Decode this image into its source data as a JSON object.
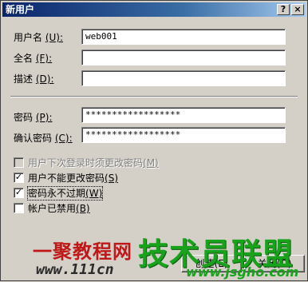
{
  "window": {
    "title": "新用户",
    "help_glyph": "?",
    "close_glyph": "×"
  },
  "form": {
    "username": {
      "label": "用户名",
      "mnemonic": "(U):",
      "value": "web001"
    },
    "fullname": {
      "label": "全名",
      "mnemonic": "(F):",
      "value": ""
    },
    "description": {
      "label": "描述",
      "mnemonic": "(D):",
      "value": ""
    },
    "password": {
      "label": "密码",
      "mnemonic": "(P):",
      "value": "******************"
    },
    "confirm_password": {
      "label": "确认密码",
      "mnemonic": "(C):",
      "value": "******************"
    }
  },
  "checkboxes": [
    {
      "label": "用户下次登录时须更改密码",
      "mnemonic": "(M)",
      "checked": false,
      "disabled": true,
      "mark": ""
    },
    {
      "label": "用户不能更改密码",
      "mnemonic": "(S)",
      "checked": true,
      "disabled": false,
      "mark": "✓"
    },
    {
      "label": "密码永不过期",
      "mnemonic": "(W)",
      "checked": true,
      "disabled": false,
      "mark": "✓"
    },
    {
      "label": "帐户已禁用",
      "mnemonic": "(B)",
      "checked": false,
      "disabled": false,
      "mark": ""
    }
  ],
  "buttons": {
    "create": "创建(E)",
    "close": "关闭(O)"
  },
  "watermark": {
    "brand_left": "一聚教程网",
    "brand_right": "技术员联盟",
    "url_left": "www.111cn",
    "url_right": "www.jsgho.com"
  }
}
